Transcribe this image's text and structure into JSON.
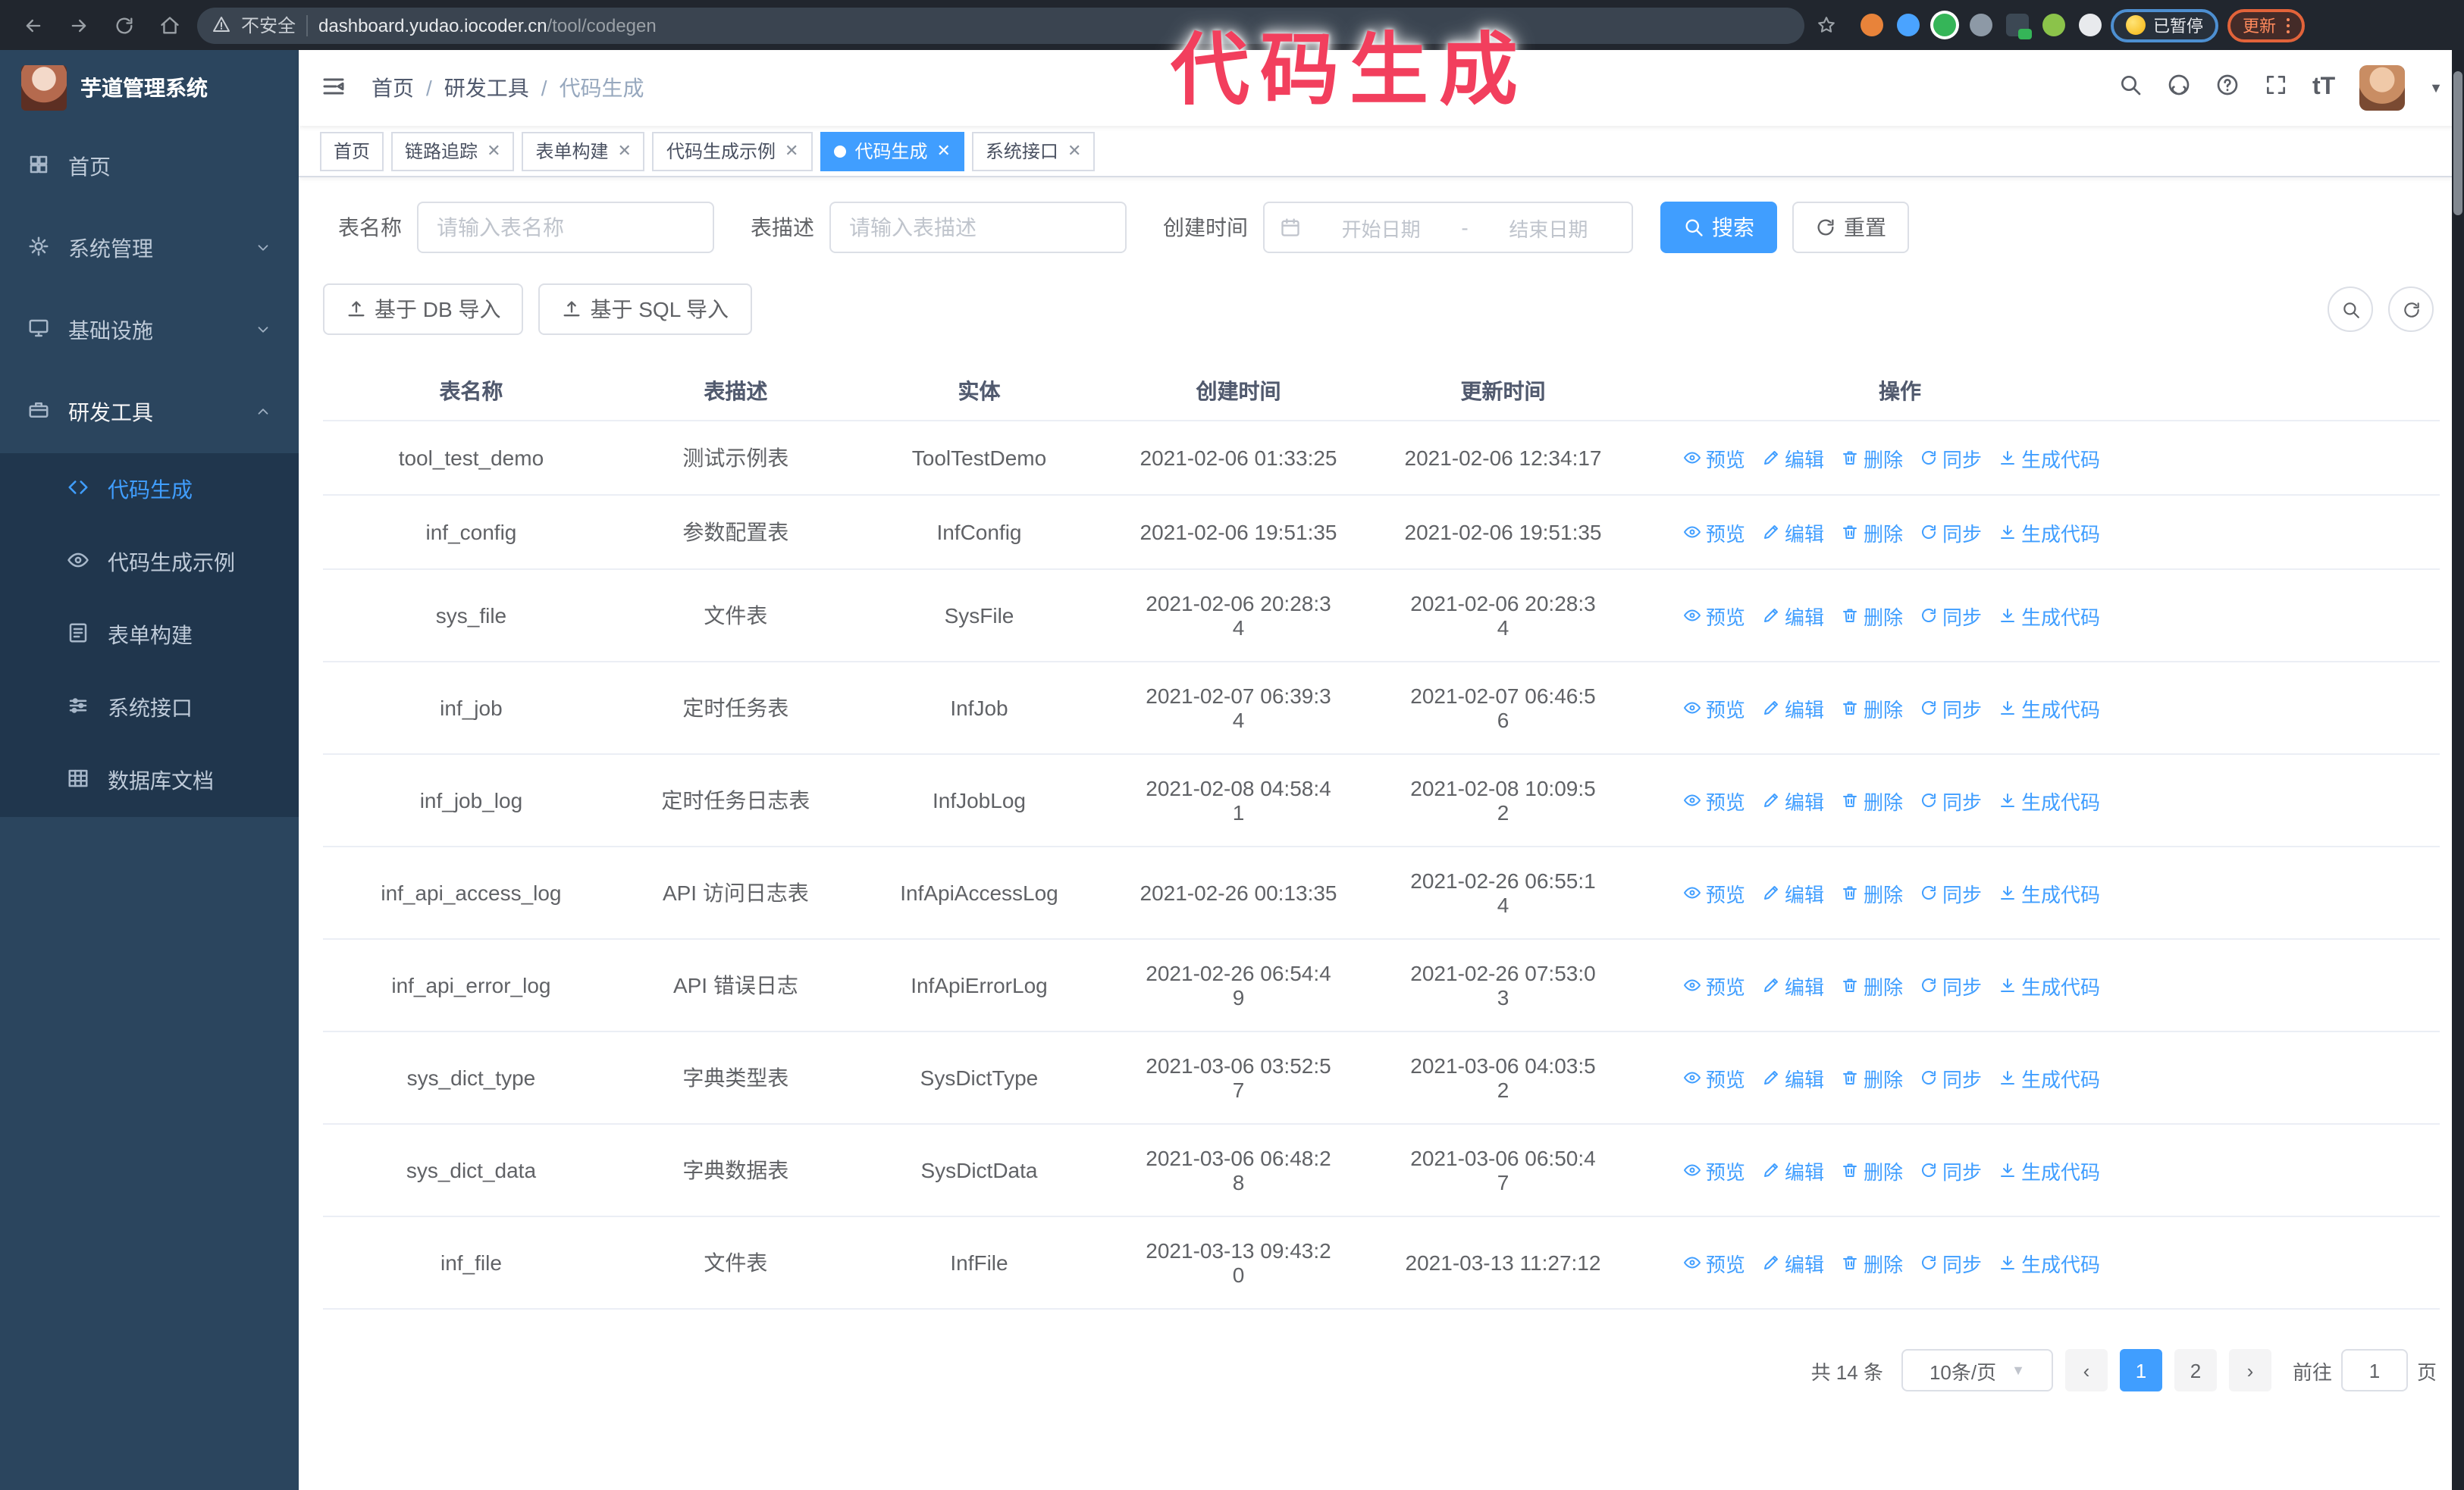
{
  "browser": {
    "security_label": "不安全",
    "url_domain": "dashboard.yudao.iocoder.cn",
    "url_path": "/tool/codegen",
    "paused_badge": "已暂停",
    "update_button": "更新",
    "nav_icons": [
      "back-icon",
      "forward-icon",
      "reload-icon",
      "home-icon"
    ],
    "extension_icons": [
      "orange-extension-icon",
      "blue-gem-extension-icon",
      "green-shield-extension-icon",
      "grey-switch-extension-icon",
      "dark-on-extension-icon",
      "green-robot-extension-icon",
      "white-puzzle-extension-icon"
    ]
  },
  "watermark_text": "代码生成",
  "sidebar": {
    "app_title": "芋道管理系统",
    "items": [
      {
        "label": "首页",
        "icon": "dashboard-icon",
        "expandable": false,
        "expanded": false,
        "active": false
      },
      {
        "label": "系统管理",
        "icon": "gear-icon",
        "expandable": true,
        "expanded": false,
        "active": false
      },
      {
        "label": "基础设施",
        "icon": "infra-icon",
        "expandable": true,
        "expanded": false,
        "active": false
      },
      {
        "label": "研发工具",
        "icon": "tools-icon",
        "expandable": true,
        "expanded": true,
        "active": true
      }
    ],
    "submenu": [
      {
        "label": "代码生成",
        "icon": "code-icon",
        "active": true
      },
      {
        "label": "代码生成示例",
        "icon": "example-icon",
        "active": false
      },
      {
        "label": "表单构建",
        "icon": "form-icon",
        "active": false
      },
      {
        "label": "系统接口",
        "icon": "api-icon",
        "active": false
      },
      {
        "label": "数据库文档",
        "icon": "database-icon",
        "active": false
      }
    ]
  },
  "header": {
    "breadcrumb": [
      "首页",
      "研发工具",
      "代码生成"
    ],
    "right_icons": [
      "search-icon",
      "github-icon",
      "help-icon",
      "fullscreen-icon",
      "font-size-icon"
    ]
  },
  "tabs": [
    {
      "label": "首页",
      "closable": false,
      "active": false
    },
    {
      "label": "链路追踪",
      "closable": true,
      "active": false
    },
    {
      "label": "表单构建",
      "closable": true,
      "active": false
    },
    {
      "label": "代码生成示例",
      "closable": true,
      "active": false
    },
    {
      "label": "代码生成",
      "closable": true,
      "active": true
    },
    {
      "label": "系统接口",
      "closable": true,
      "active": false
    }
  ],
  "filters": {
    "name_label": "表名称",
    "name_placeholder": "请输入表名称",
    "desc_label": "表描述",
    "desc_placeholder": "请输入表描述",
    "date_label": "创建时间",
    "date_start_placeholder": "开始日期",
    "date_separator": "-",
    "date_end_placeholder": "结束日期",
    "search_label": "搜索",
    "reset_label": "重置"
  },
  "toolbar": {
    "import_db_label": "基于 DB 导入",
    "import_sql_label": "基于 SQL 导入"
  },
  "table": {
    "columns": [
      "表名称",
      "表描述",
      "实体",
      "创建时间",
      "更新时间",
      "操作"
    ],
    "action_labels": [
      "预览",
      "编辑",
      "删除",
      "同步",
      "生成代码"
    ],
    "action_icons": [
      "view-icon",
      "edit-icon",
      "delete-icon",
      "sync-icon",
      "download-icon"
    ],
    "rows": [
      {
        "name": "tool_test_demo",
        "desc": "测试示例表",
        "entity": "ToolTestDemo",
        "created": "2021-02-06 01:33:25",
        "updated": "2021-02-06 12:34:17",
        "cwrap": false,
        "uwrap": false
      },
      {
        "name": "inf_config",
        "desc": "参数配置表",
        "entity": "InfConfig",
        "created": "2021-02-06 19:51:35",
        "updated": "2021-02-06 19:51:35",
        "cwrap": false,
        "uwrap": false
      },
      {
        "name": "sys_file",
        "desc": "文件表",
        "entity": "SysFile",
        "created": "2021-02-06 20:28:34",
        "updated": "2021-02-06 20:28:34",
        "cwrap": true,
        "uwrap": true
      },
      {
        "name": "inf_job",
        "desc": "定时任务表",
        "entity": "InfJob",
        "created": "2021-02-07 06:39:34",
        "updated": "2021-02-07 06:46:56",
        "cwrap": true,
        "uwrap": true
      },
      {
        "name": "inf_job_log",
        "desc": "定时任务日志表",
        "entity": "InfJobLog",
        "created": "2021-02-08 04:58:41",
        "updated": "2021-02-08 10:09:52",
        "cwrap": true,
        "uwrap": true
      },
      {
        "name": "inf_api_access_log",
        "desc": "API 访问日志表",
        "entity": "InfApiAccessLog",
        "created": "2021-02-26 00:13:35",
        "updated": "2021-02-26 06:55:14",
        "cwrap": false,
        "uwrap": true
      },
      {
        "name": "inf_api_error_log",
        "desc": "API 错误日志",
        "entity": "InfApiErrorLog",
        "created": "2021-02-26 06:54:49",
        "updated": "2021-02-26 07:53:03",
        "cwrap": true,
        "uwrap": true
      },
      {
        "name": "sys_dict_type",
        "desc": "字典类型表",
        "entity": "SysDictType",
        "created": "2021-03-06 03:52:57",
        "updated": "2021-03-06 04:03:52",
        "cwrap": true,
        "uwrap": true
      },
      {
        "name": "sys_dict_data",
        "desc": "字典数据表",
        "entity": "SysDictData",
        "created": "2021-03-06 06:48:28",
        "updated": "2021-03-06 06:50:47",
        "cwrap": true,
        "uwrap": true
      },
      {
        "name": "inf_file",
        "desc": "文件表",
        "entity": "InfFile",
        "created": "2021-03-13 09:43:20",
        "updated": "2021-03-13 11:27:12",
        "cwrap": true,
        "uwrap": false
      }
    ]
  },
  "pagination": {
    "total_text": "共 14 条",
    "page_size": "10条/页",
    "pages": [
      "1",
      "2"
    ],
    "active_page": "1",
    "goto_label": "前往",
    "goto_value": "1",
    "goto_suffix": "页"
  },
  "colors": {
    "primary": "#409EFF",
    "watermark": "#F23F5D",
    "sidebar_bg": "#2B455E",
    "submenu_bg": "#20364D",
    "browser_bar_bg": "#21262E",
    "update_button_accent": "#E2633A",
    "paused_badge_border": "#4D8FD1"
  }
}
